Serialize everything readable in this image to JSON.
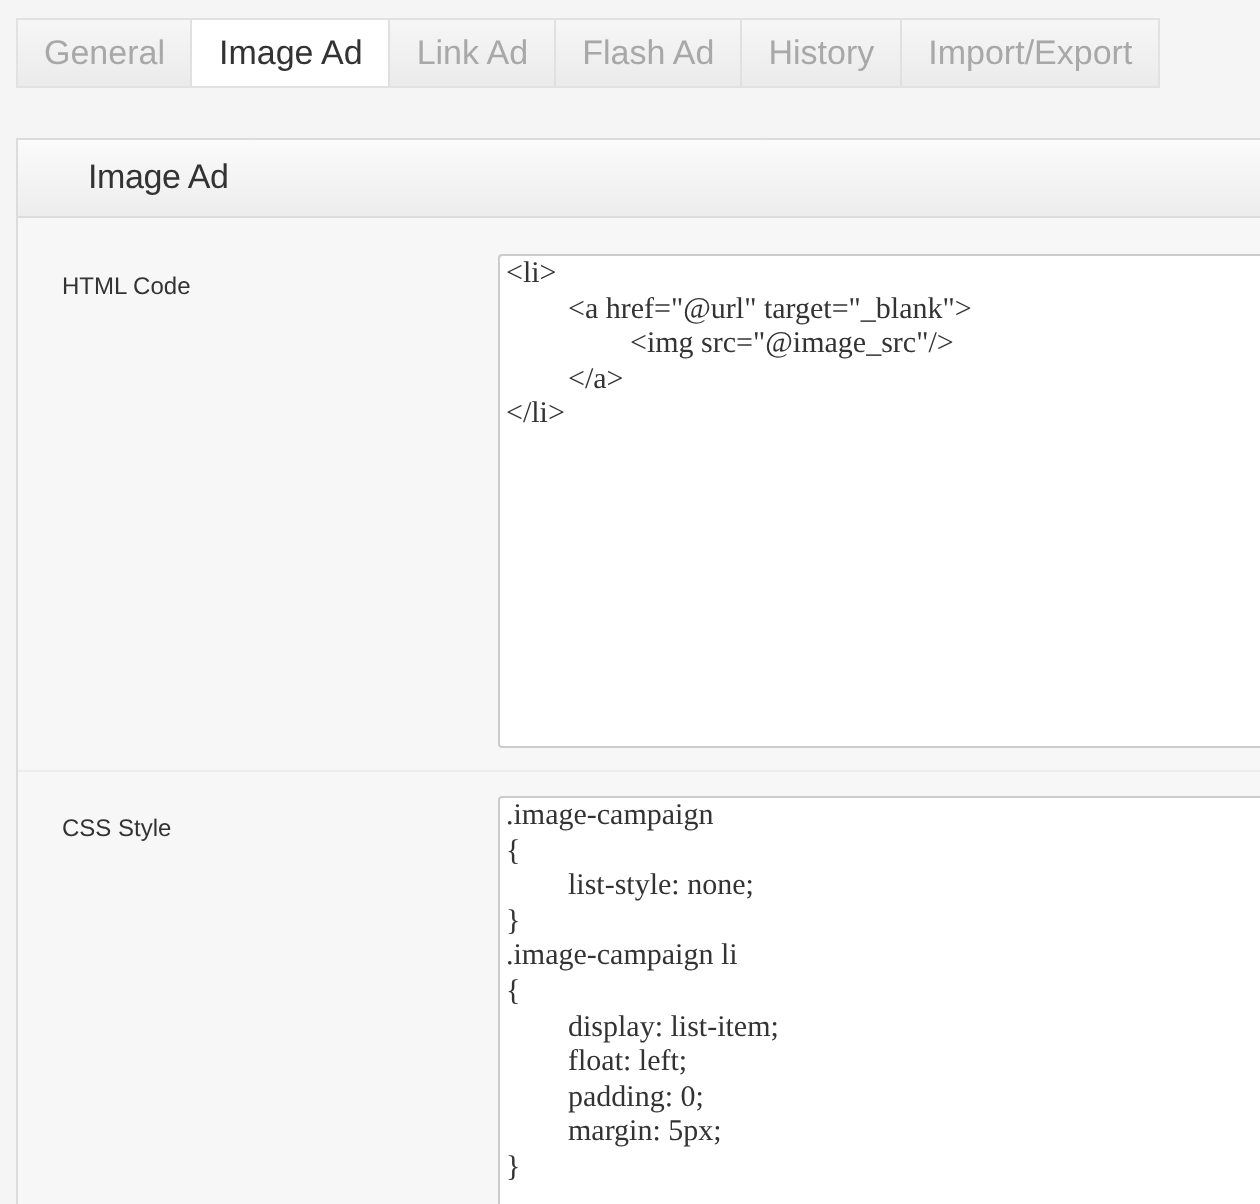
{
  "tabs": [
    {
      "label": "General",
      "selected": false
    },
    {
      "label": "Image Ad",
      "selected": true
    },
    {
      "label": "Link Ad",
      "selected": false
    },
    {
      "label": "Flash Ad",
      "selected": false
    },
    {
      "label": "History",
      "selected": false
    },
    {
      "label": "Import/Export",
      "selected": false
    }
  ],
  "panel": {
    "title": "Image Ad",
    "fields": [
      {
        "label": "HTML Code",
        "value": "<li>\n\t<a href=\"@url\" target=\"_blank\">\n\t\t<img src=\"@image_src\"/>\n\t</a>\n</li>"
      },
      {
        "label": "CSS Style",
        "value": ".image-campaign\n{\n\tlist-style: none;\n}\n.image-campaign li\n{\n\tdisplay: list-item;\n\tfloat: left;\n\tpadding: 0;\n\tmargin: 5px;\n}"
      }
    ]
  }
}
